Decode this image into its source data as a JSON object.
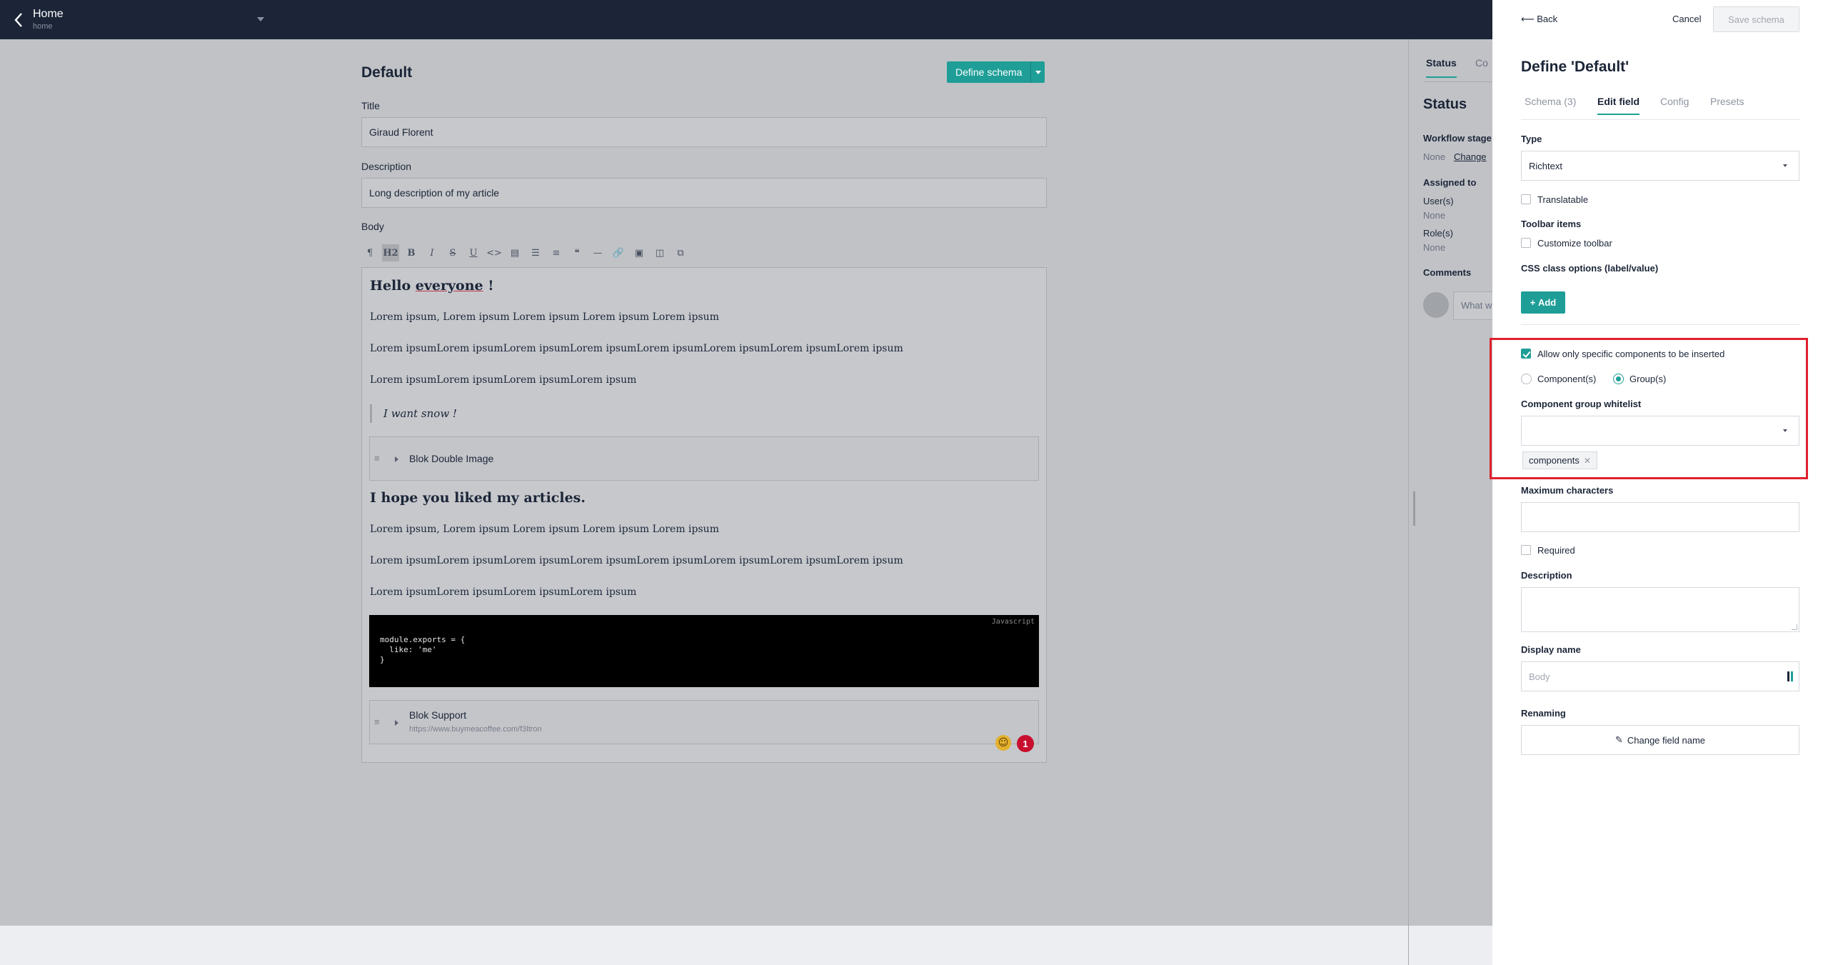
{
  "topbar": {
    "title": "Home",
    "subtitle": "home"
  },
  "document": {
    "title": "Default",
    "define_schema_label": "Define schema",
    "fields": [
      {
        "label": "Title",
        "value": "Giraud Florent"
      },
      {
        "label": "Description",
        "value": "Long description of my article"
      }
    ],
    "body_label": "Body",
    "toolbar": [
      "¶",
      "H2",
      "B",
      "I",
      "S",
      "U",
      "<>",
      "▤",
      "☰",
      "≡",
      "❝",
      "—",
      "🔗",
      "▣",
      "◫",
      "⧉"
    ],
    "content": {
      "h1_pre": "Hello ",
      "h1_underlined": "everyone",
      "h1_post": " !",
      "paragraphs_1": [
        "Lorem ipsum, Lorem ipsum Lorem ipsum Lorem ipsum Lorem ipsum",
        "Lorem ipsumLorem ipsumLorem ipsumLorem ipsumLorem ipsumLorem ipsumLorem ipsumLorem ipsum",
        "Lorem ipsumLorem ipsumLorem ipsumLorem ipsum"
      ],
      "quote": "I want snow !",
      "blok_1": "Blok Double Image",
      "h2": "I hope you liked my articles.",
      "paragraphs_2": [
        "Lorem ipsum, Lorem ipsum Lorem ipsum Lorem ipsum Lorem ipsum",
        "Lorem ipsumLorem ipsumLorem ipsumLorem ipsumLorem ipsumLorem ipsumLorem ipsumLorem ipsum",
        "Lorem ipsumLorem ipsumLorem ipsumLorem ipsum"
      ],
      "code_lang": "Javascript",
      "code": "module.exports = {\n  like: 'me'\n}",
      "blok_2": "Blok Support",
      "blok_2_url": "https://www.buymeacoffee.com/f3ltron",
      "badge_count": "1"
    }
  },
  "status_panel": {
    "tabs": [
      "Status",
      "Co"
    ],
    "heading": "Status",
    "workflow_label": "Workflow stage",
    "workflow_value": "None",
    "change_link": "Change",
    "assigned_label": "Assigned to",
    "users_label": "User(s)",
    "users_value": "None",
    "roles_label": "Role(s)",
    "roles_value": "None",
    "comments_label": "Comments",
    "comment_placeholder": "What w"
  },
  "schema_panel": {
    "back_label": "Back",
    "cancel_label": "Cancel",
    "save_label": "Save schema",
    "title": "Define 'Default'",
    "tabs": [
      "Schema (3)",
      "Edit field",
      "Config",
      "Presets"
    ],
    "type_label": "Type",
    "type_value": "Richtext",
    "translatable_label": "Translatable",
    "toolbar_items_label": "Toolbar items",
    "customize_toolbar_label": "Customize toolbar",
    "css_class_label": "CSS class options (label/value)",
    "add_label": "Add",
    "allow_specific_label": "Allow only specific components to be inserted",
    "components_option": "Component(s)",
    "groups_option": "Group(s)",
    "whitelist_label": "Component group whitelist",
    "whitelist_tag": "components",
    "max_chars_label": "Maximum characters",
    "required_label": "Required",
    "description_label": "Description",
    "display_name_label": "Display name",
    "display_name_placeholder": "Body",
    "renaming_label": "Renaming",
    "change_field_name_label": "Change field name"
  }
}
